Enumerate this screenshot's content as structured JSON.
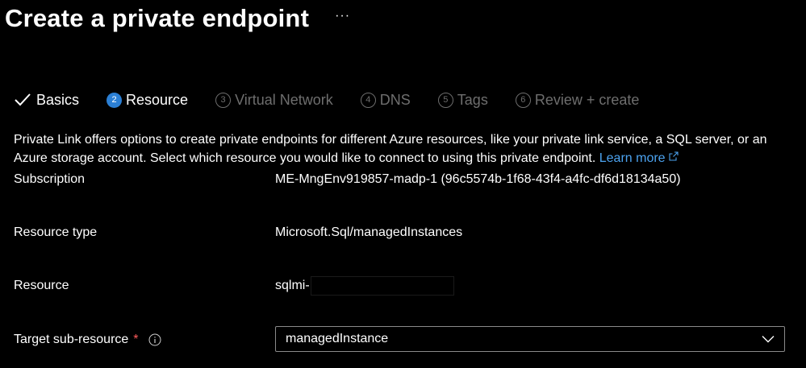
{
  "page": {
    "title": "Create a private endpoint",
    "more_label": "···"
  },
  "tabs": [
    {
      "number": "",
      "label": "Basics",
      "state": "done"
    },
    {
      "number": "2",
      "label": "Resource",
      "state": "active"
    },
    {
      "number": "3",
      "label": "Virtual Network",
      "state": "pending"
    },
    {
      "number": "4",
      "label": "DNS",
      "state": "pending"
    },
    {
      "number": "5",
      "label": "Tags",
      "state": "pending"
    },
    {
      "number": "6",
      "label": "Review + create",
      "state": "pending"
    }
  ],
  "intro": {
    "text": "Private Link offers options to create private endpoints for different Azure resources, like your private link service, a SQL server, or an Azure storage account. Select which resource you would like to connect to using this private endpoint.",
    "learn_more": "Learn more"
  },
  "fields": {
    "subscription": {
      "label": "Subscription",
      "value": "ME-MngEnv919857-madp-1 (96c5574b-1f68-43f4-a4fc-df6d18134a50)"
    },
    "resource_type": {
      "label": "Resource type",
      "value": "Microsoft.Sql/managedInstances"
    },
    "resource": {
      "label": "Resource",
      "value": "sqlmi-"
    },
    "target_sub_resource": {
      "label": "Target sub-resource",
      "required_mark": "*",
      "value": "managedInstance"
    }
  },
  "colors": {
    "background": "#000000",
    "accent": "#2b7fd4",
    "link": "#4ca3f0",
    "required": "#ff5c5c",
    "pending_text": "#6e6e6e"
  }
}
